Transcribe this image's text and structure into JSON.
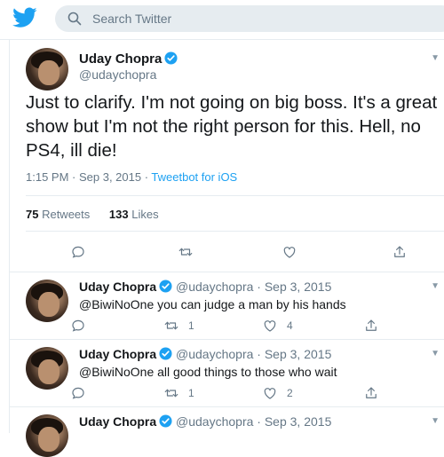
{
  "search": {
    "placeholder": "Search Twitter"
  },
  "tweet": {
    "name": "Uday Chopra",
    "handle": "@udaychopra",
    "text": "Just to clarify. I'm not going on big boss. It's a great show but I'm not the right person for this. Hell, no PS4, ill die!",
    "time": "1:15 PM · Sep 3, 2015 · ",
    "source": "Tweetbot for iOS",
    "retweets": "75",
    "retweets_label": " Retweets",
    "likes": "133",
    "likes_label": " Likes"
  },
  "replies": [
    {
      "name": "Uday Chopra",
      "handle": "@udaychopra",
      "date": "· Sep 3, 2015",
      "text": "@BiwiNoOne you can judge a man by his hands",
      "retweets": "1",
      "likes": "4"
    },
    {
      "name": "Uday Chopra",
      "handle": "@udaychopra",
      "date": "· Sep 3, 2015",
      "text": "@BiwiNoOne all good things to those who wait",
      "retweets": "1",
      "likes": "2"
    },
    {
      "name": "Uday Chopra",
      "handle": "@udaychopra",
      "date": "· Sep 3, 2015",
      "text": ""
    }
  ],
  "colors": {
    "brand": "#1da1f2",
    "muted": "#657786",
    "border": "#e6ecf0"
  },
  "icons": [
    "twitter-bird-icon",
    "search-icon",
    "verified-badge-icon",
    "reply-icon",
    "retweet-icon",
    "like-icon",
    "share-icon",
    "chevron-down-icon"
  ]
}
